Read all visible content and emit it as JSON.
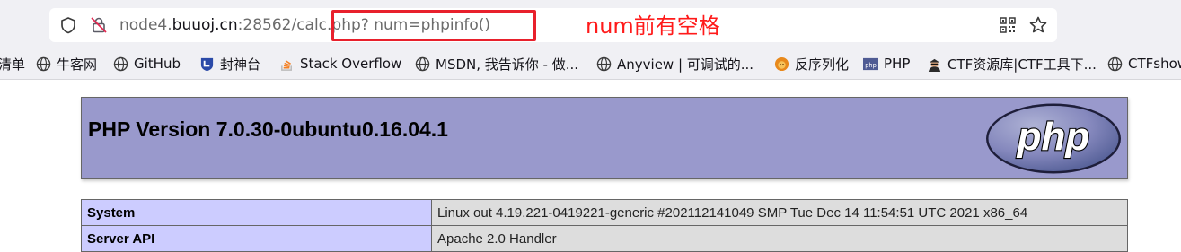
{
  "url": {
    "host_prefix": "node4.",
    "host_domain": "buuoj.cn",
    "rest": ":28562/calc.php? num=phpinfo()"
  },
  "annotation": "num前有空格",
  "bookmarks": [
    {
      "label": "清单",
      "icon": "none"
    },
    {
      "label": "牛客网",
      "icon": "globe-icon"
    },
    {
      "label": "GitHub",
      "icon": "globe-icon"
    },
    {
      "label": "封神台",
      "icon": "shield-logo-icon"
    },
    {
      "label": "Stack Overflow",
      "icon": "stackoverflow-icon"
    },
    {
      "label": "MSDN, 我告诉你 - 做...",
      "icon": "globe-icon"
    },
    {
      "label": "Anyview | 可调试的...",
      "icon": "globe-icon"
    },
    {
      "label": "反序列化",
      "icon": "lion-icon"
    },
    {
      "label": "PHP",
      "icon": "php-icon"
    },
    {
      "label": "CTF资源库|CTF工具下...",
      "icon": "hacker-icon"
    },
    {
      "label": "CTFshow",
      "icon": "globe-icon"
    }
  ],
  "php": {
    "title": "PHP Version 7.0.30-0ubuntu0.16.04.1",
    "logo_text": "php",
    "rows": [
      {
        "key": "System",
        "value": "Linux out 4.19.221-0419221-generic #202112141049 SMP Tue Dec 14 11:54:51 UTC 2021 x86_64"
      },
      {
        "key": "Server API",
        "value": "Apache 2.0 Handler"
      }
    ]
  },
  "colors": {
    "header_bg": "#9999cc",
    "key_cell_bg": "#ccccff",
    "value_cell_bg": "#dddddd",
    "annotation_red": "#ff1a1a"
  }
}
